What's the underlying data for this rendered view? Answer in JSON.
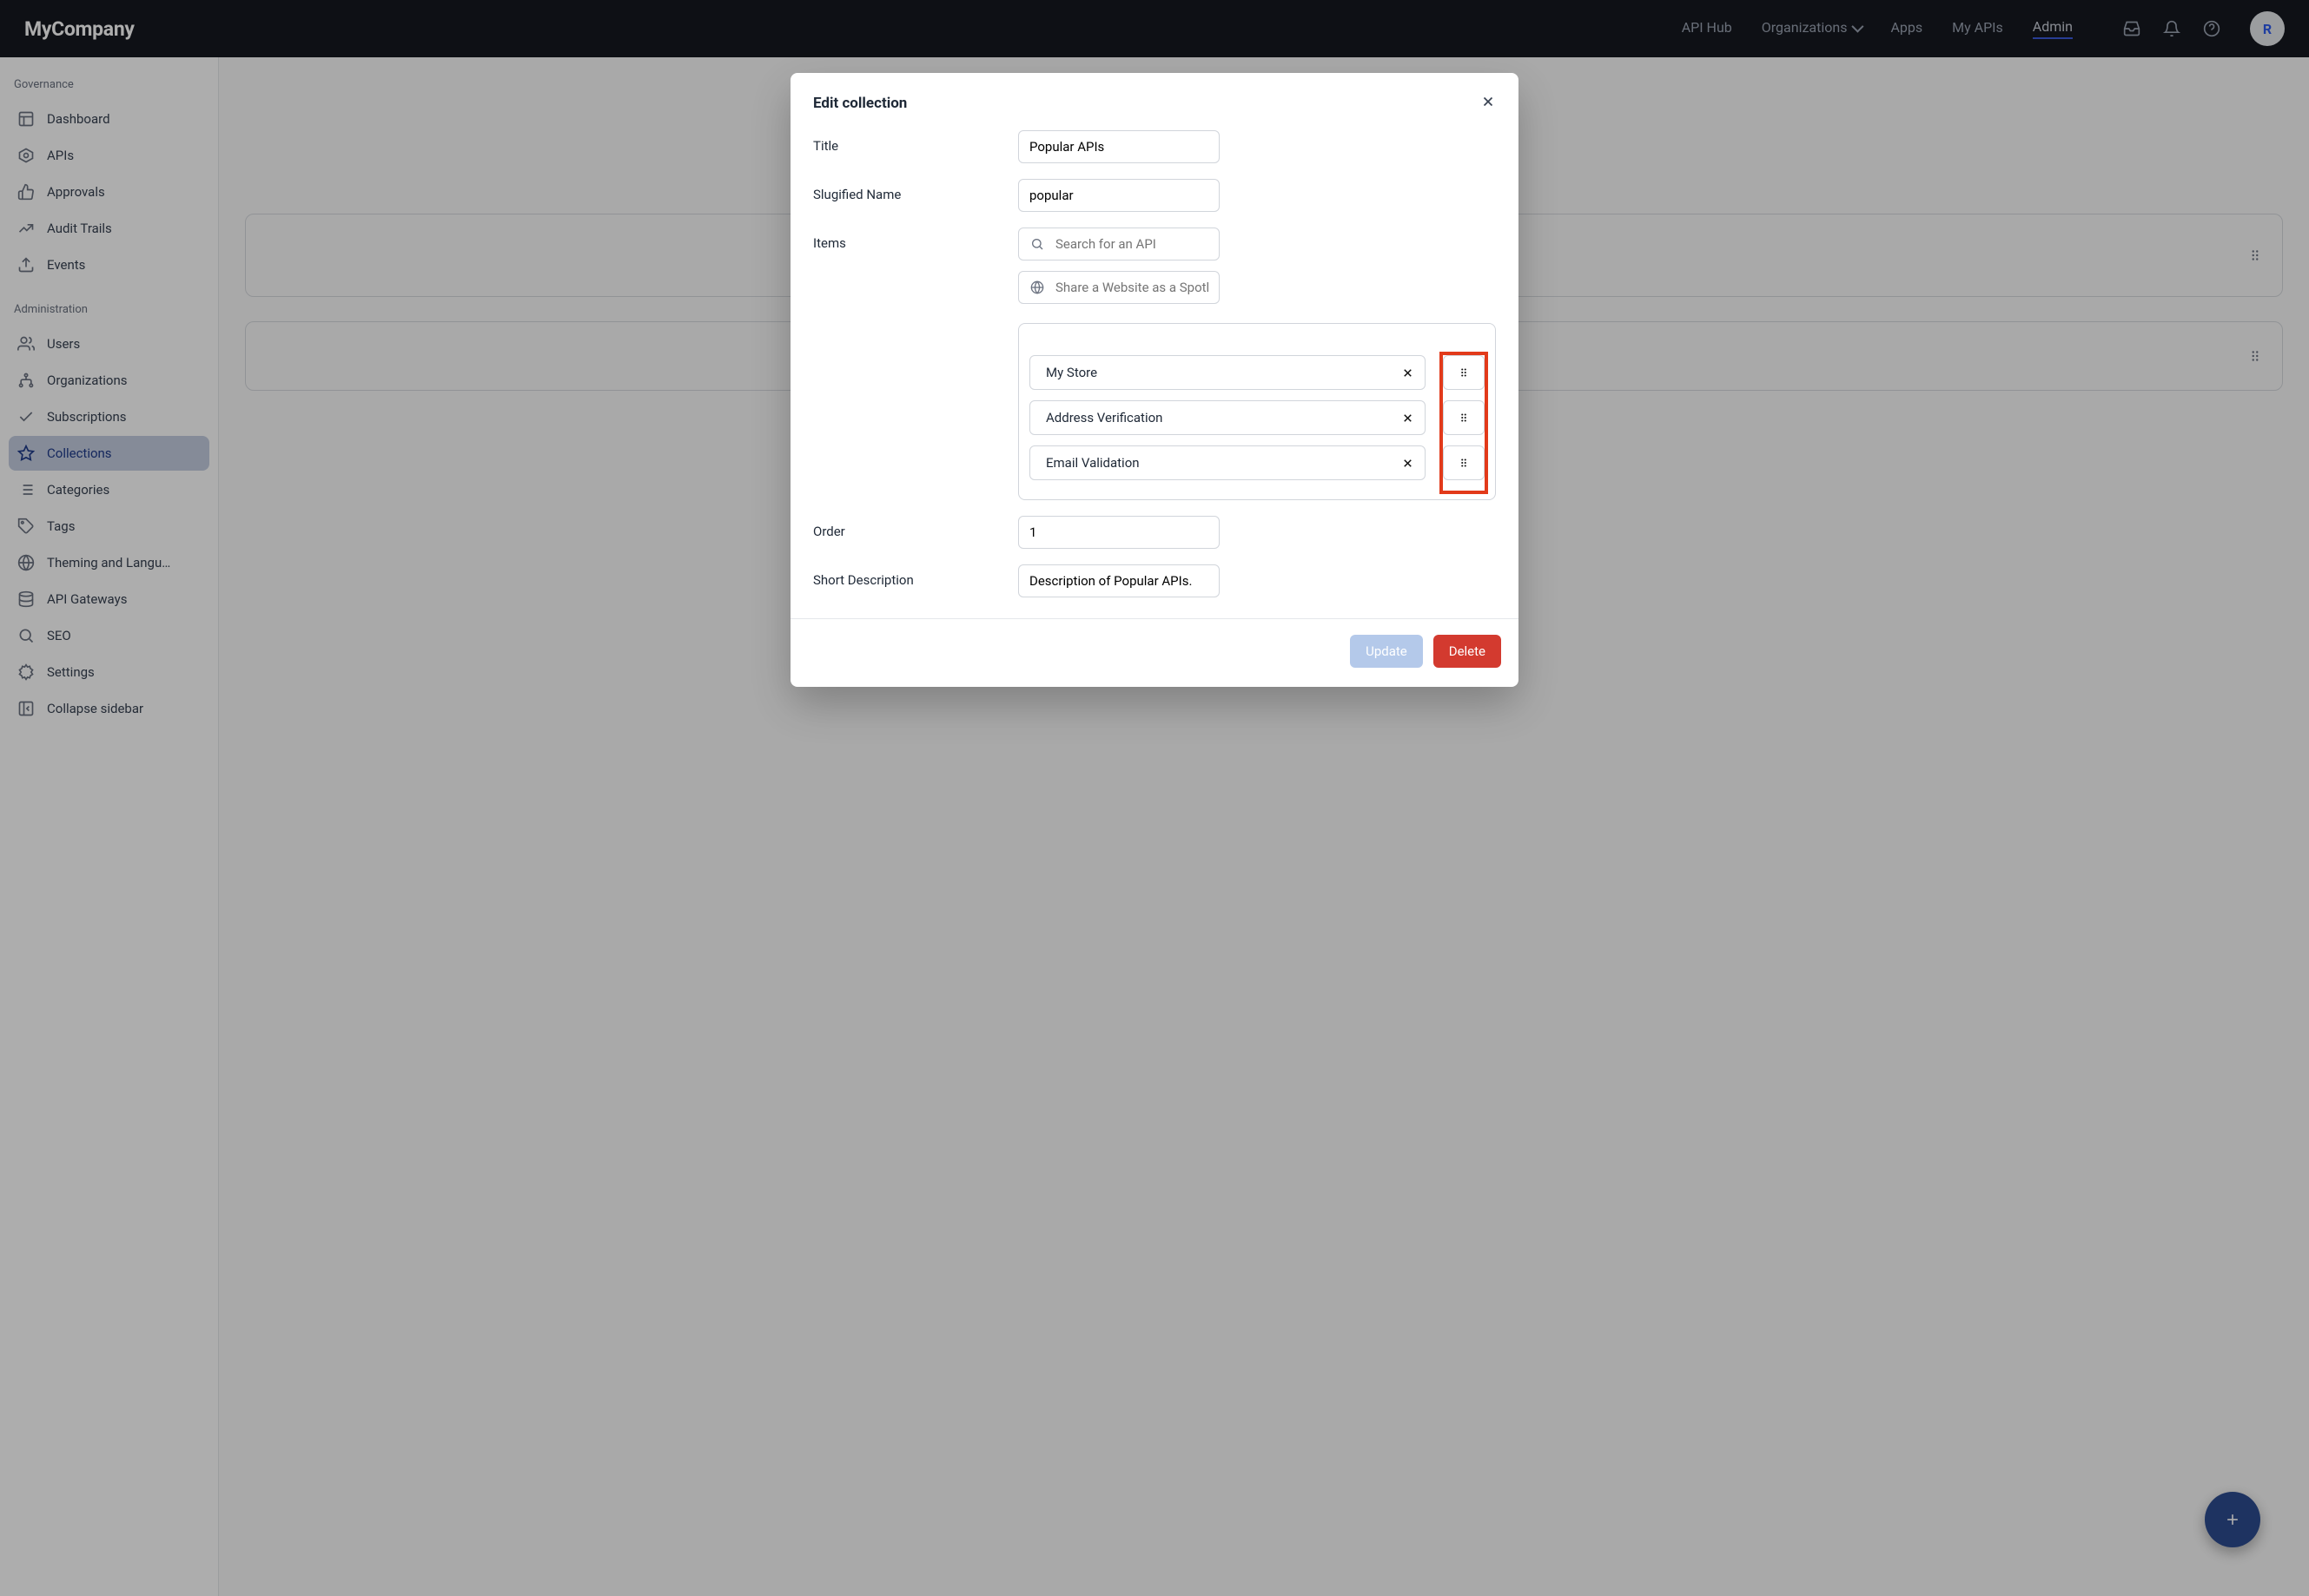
{
  "header": {
    "logo": "MyCompany",
    "nav": [
      {
        "label": "API Hub"
      },
      {
        "label": "Organizations",
        "dropdown": true
      },
      {
        "label": "Apps"
      },
      {
        "label": "My APIs"
      },
      {
        "label": "Admin",
        "active": true
      }
    ],
    "avatar_initial": "R"
  },
  "sidebar": {
    "groups": [
      {
        "title": "Governance",
        "items": [
          {
            "name": "dashboard",
            "label": "Dashboard",
            "icon": "layout"
          },
          {
            "name": "apis",
            "label": "APIs",
            "icon": "hex"
          },
          {
            "name": "approvals",
            "label": "Approvals",
            "icon": "thumb"
          },
          {
            "name": "audit-trails",
            "label": "Audit Trails",
            "icon": "chart"
          },
          {
            "name": "events",
            "label": "Events",
            "icon": "upload"
          }
        ]
      },
      {
        "title": "Administration",
        "items": [
          {
            "name": "users",
            "label": "Users",
            "icon": "users"
          },
          {
            "name": "organizations",
            "label": "Organizations",
            "icon": "tree"
          },
          {
            "name": "subscriptions",
            "label": "Subscriptions",
            "icon": "check"
          },
          {
            "name": "collections",
            "label": "Collections",
            "icon": "star",
            "active": true
          },
          {
            "name": "categories",
            "label": "Categories",
            "icon": "list"
          },
          {
            "name": "tags",
            "label": "Tags",
            "icon": "tag"
          },
          {
            "name": "theming",
            "label": "Theming and Langu…",
            "icon": "globe"
          },
          {
            "name": "gateways",
            "label": "API Gateways",
            "icon": "db"
          },
          {
            "name": "seo",
            "label": "SEO",
            "icon": "search"
          },
          {
            "name": "settings",
            "label": "Settings",
            "icon": "cog"
          },
          {
            "name": "collapse",
            "label": "Collapse sidebar",
            "icon": "collapse"
          }
        ]
      }
    ]
  },
  "modal": {
    "heading": "Edit collection",
    "fields": {
      "title_label": "Title",
      "title_value": "Popular APIs",
      "slug_label": "Slugified Name",
      "slug_value": "popular",
      "items_label": "Items",
      "search_placeholder": "Search for an API",
      "spotlight_placeholder": "Share a Website as a Spotlight: https://…",
      "order_label": "Order",
      "order_value": "1",
      "desc_label": "Short Description",
      "desc_value": "Description of Popular APIs."
    },
    "items": [
      {
        "label": "My Store"
      },
      {
        "label": "Address Verification"
      },
      {
        "label": "Email Validation"
      }
    ],
    "update_label": "Update",
    "delete_label": "Delete"
  }
}
